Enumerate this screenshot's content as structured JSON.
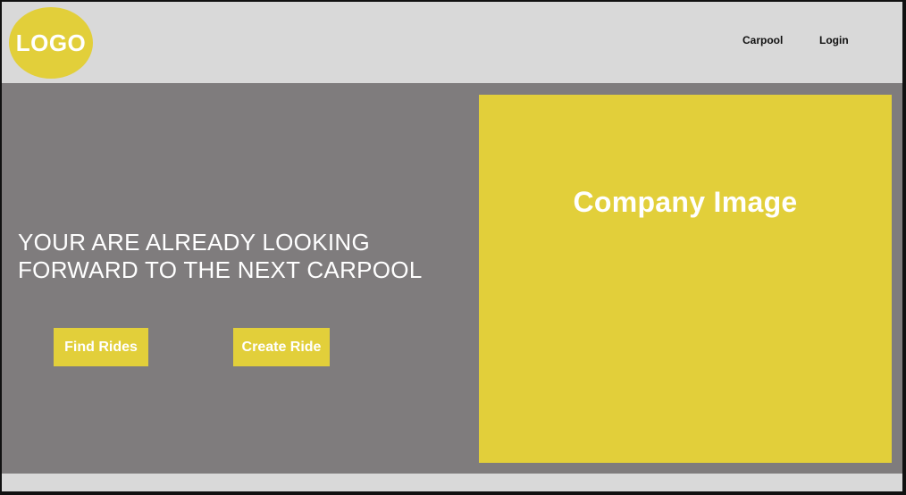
{
  "header": {
    "logo_text": "LOGO",
    "nav": {
      "carpool": "Carpool",
      "login": "Login"
    }
  },
  "hero": {
    "headline_line1": "YOUR ARE ALREADY LOOKING",
    "headline_line2": "FORWARD TO THE NEXT CARPOOL",
    "find_rides_label": "Find Rides",
    "create_ride_label": "Create Ride",
    "image_label": "Company Image"
  },
  "colors": {
    "accent": "#e2cf3a",
    "hero_background": "#7f7c7d",
    "header_background": "#d9d9d9",
    "text_light": "#ffffff",
    "text_dark": "#111111"
  }
}
